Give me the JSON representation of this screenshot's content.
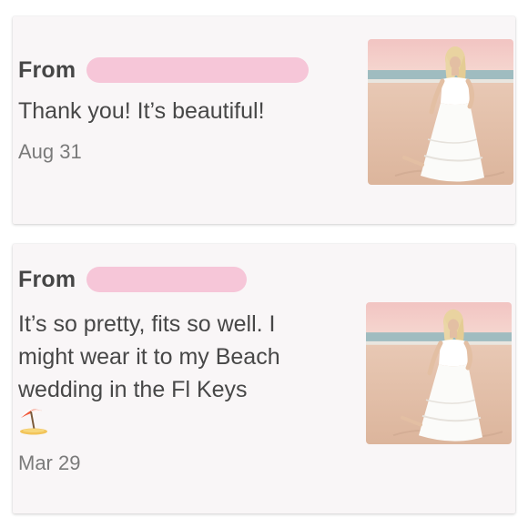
{
  "colors": {
    "card_background": "#f9f6f7",
    "redaction_pink": "#f6c6d8",
    "text_primary": "#474747",
    "text_date": "#7a7a7a"
  },
  "messages": [
    {
      "from_label": "From",
      "sender_redacted": true,
      "text": "Thank you! It’s beautiful!",
      "emoji": "",
      "date": "Aug 31",
      "photo_icon": "beach-dress-photo"
    },
    {
      "from_label": "From",
      "sender_redacted": true,
      "text": "It’s so pretty, fits so well. I\nmight wear it to my Beach\nwedding in the Fl Keys",
      "emoji": "⛱",
      "date": "Mar 29",
      "photo_icon": "beach-dress-photo"
    }
  ]
}
